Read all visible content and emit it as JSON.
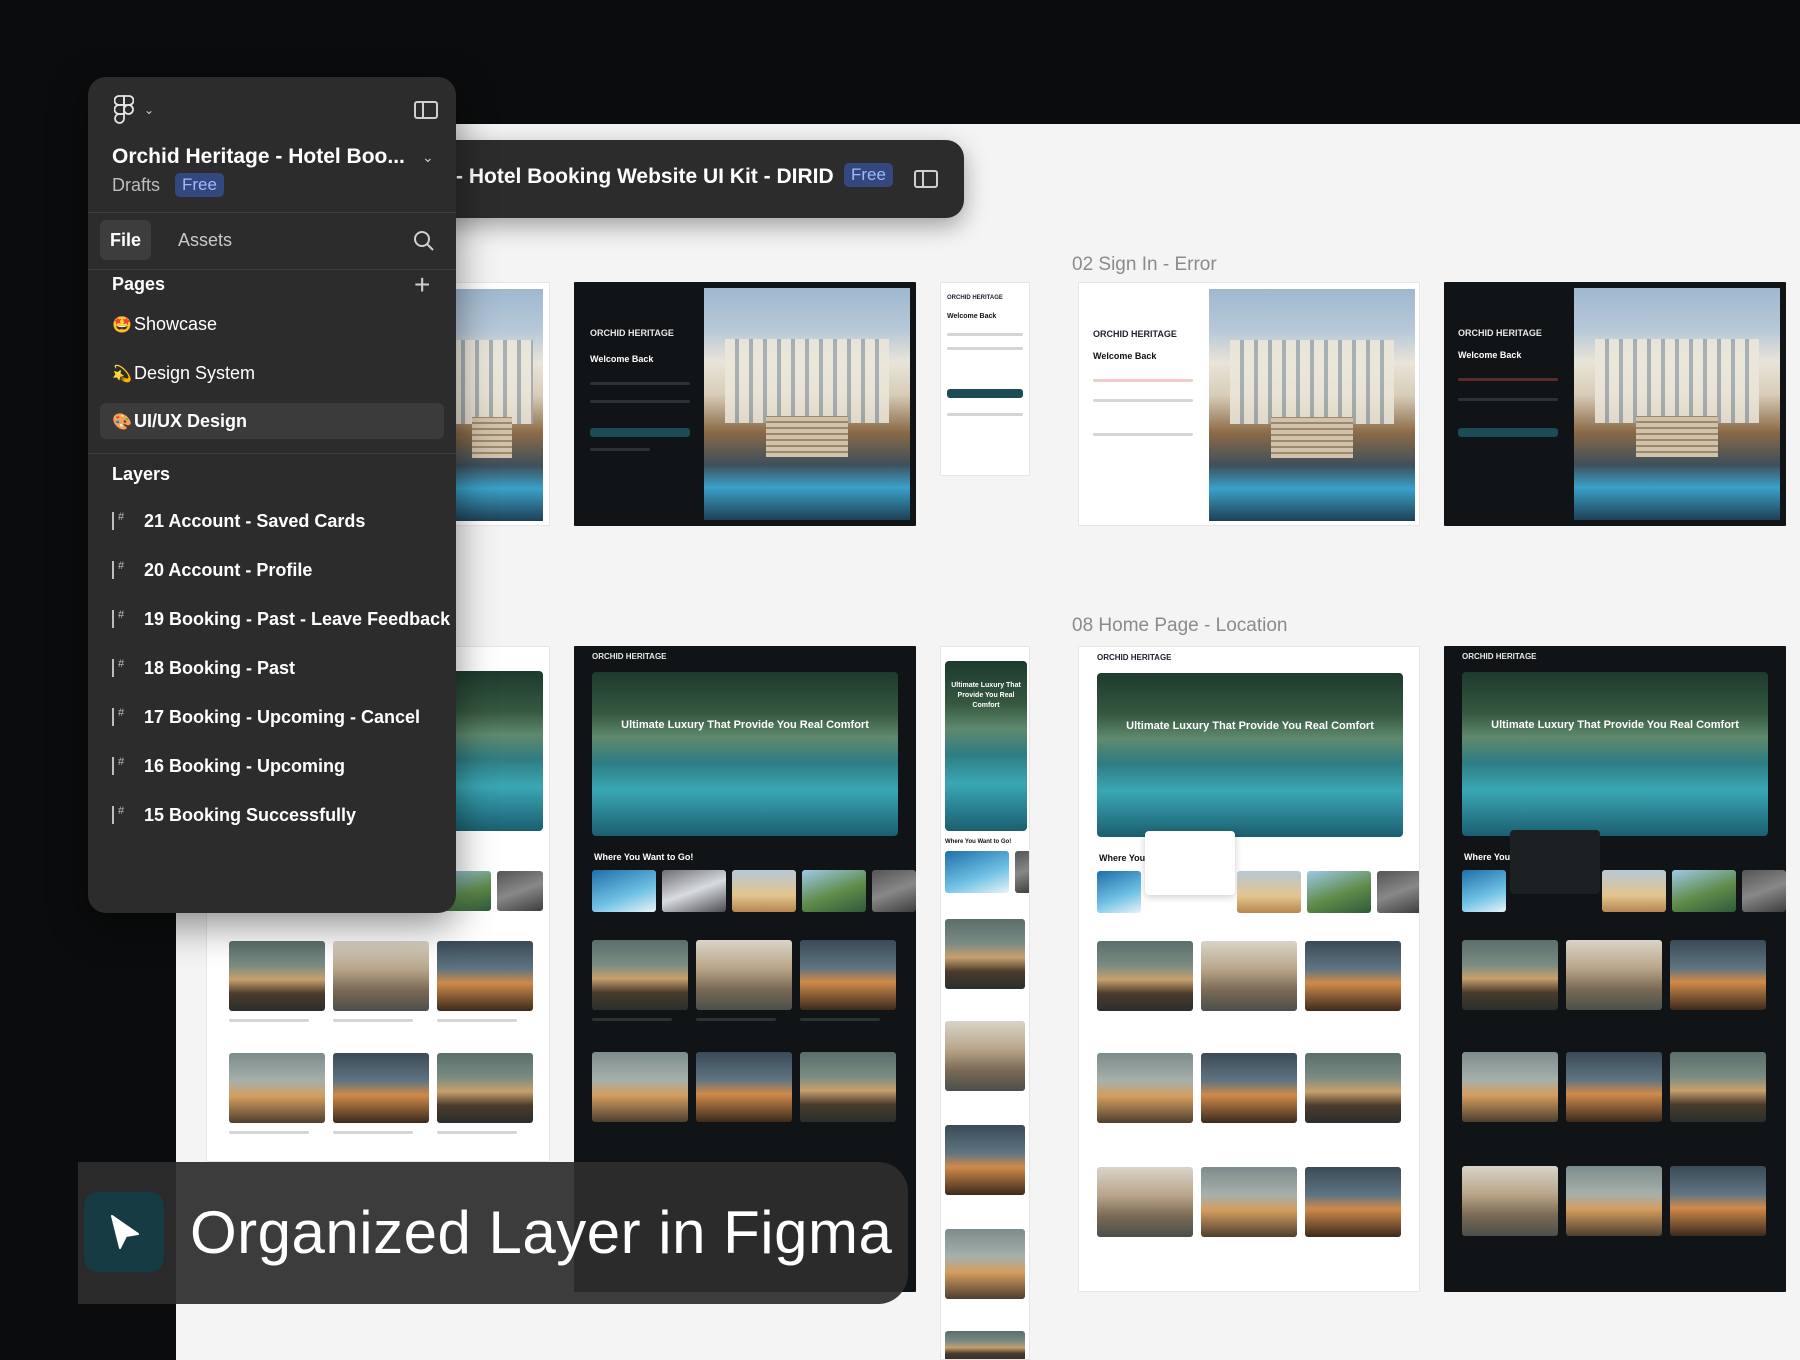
{
  "app": {
    "file_name": "Orchid Heritage - Hotel Boo...",
    "location": "Drafts",
    "plan_badge": "Free"
  },
  "titlebar": {
    "title": "- Hotel Booking Website UI Kit - DIRID",
    "badge": "Free"
  },
  "tabs": {
    "file": "File",
    "assets": "Assets"
  },
  "pages": {
    "title": "Pages",
    "items": [
      {
        "emoji": "🤩",
        "label": "Showcase"
      },
      {
        "emoji": "💫",
        "label": "Design System"
      },
      {
        "emoji": "🎨",
        "label": "UI/UX Design"
      }
    ]
  },
  "layers": {
    "title": "Layers",
    "items": [
      "21 Account - Saved Cards",
      "20 Account - Profile",
      "19 Booking - Past - Leave Feedback",
      "18 Booking - Past",
      "17 Booking - Upcoming - Cancel",
      "16 Booking - Upcoming",
      "15 Booking Successfully"
    ]
  },
  "canvas": {
    "section_labels": [
      "02 Sign In - Error",
      "08 Home Page - Location"
    ],
    "mock": {
      "brand": "ORCHID HERITAGE",
      "welcome": "Welcome Back",
      "headline": "Ultimate Luxury That Provide You Real Comfort",
      "headline_mobile": "Ultimate Luxury That Provide You Real Comfort",
      "where": "Where You Want to Go!",
      "where_short": "Where You"
    }
  },
  "banner": {
    "text": "Organized Layer in Figma"
  },
  "colors": {
    "accent_free": "#9fb8ff",
    "badge_bg": "#34487d",
    "panel_bg": "#2c2c2c",
    "brand_teal": "#163b42"
  }
}
